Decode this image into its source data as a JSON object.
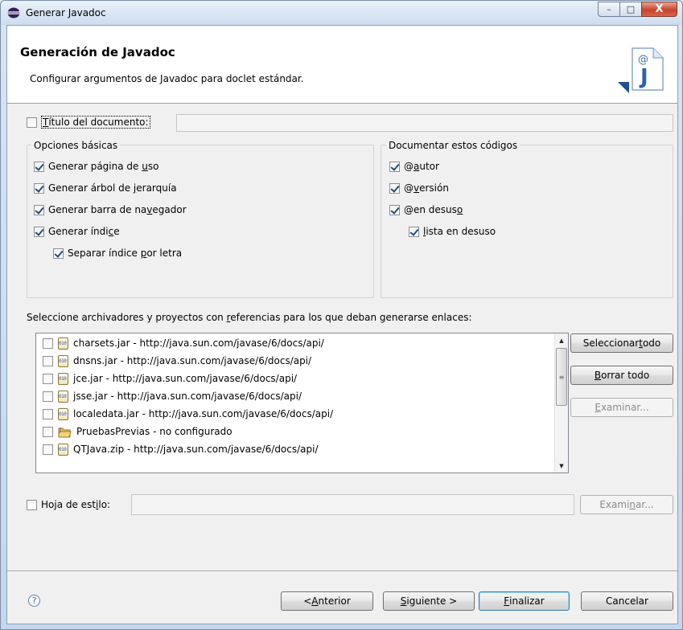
{
  "window": {
    "title": "Generar Javadoc",
    "controls": {
      "minimize": "–",
      "maximize": "□",
      "close": "X"
    }
  },
  "banner": {
    "heading": "Generación de Javadoc",
    "description": "Configurar argumentos de Javadoc para doclet estándar.",
    "icon": "javadoc-wizard-icon",
    "icon_letter": "J",
    "icon_at": "@"
  },
  "document_title": {
    "checked": false,
    "label_first": "T",
    "label_rest": "ítulo del documento:",
    "value": ""
  },
  "basic_options": {
    "legend": "Opciones básicas",
    "items": [
      {
        "pre": "Generar página de ",
        "u": "u",
        "post": "so",
        "checked": true
      },
      {
        "pre": "Generar árbol de ",
        "u": "j",
        "post": "erarquía",
        "checked": true
      },
      {
        "pre": "Generar barra de na",
        "u": "v",
        "post": "egador",
        "checked": true
      },
      {
        "pre": "Generar índi",
        "u": "c",
        "post": "e",
        "checked": true
      },
      {
        "pre": "Separar índice ",
        "u": "p",
        "post": "or letra",
        "checked": true
      }
    ]
  },
  "tags": {
    "legend": "Documentar estos códigos",
    "items": [
      {
        "pre": "@",
        "u": "a",
        "post": "utor",
        "checked": true
      },
      {
        "pre": "@",
        "u": "v",
        "post": "ersión",
        "checked": true
      },
      {
        "pre": "@en desus",
        "u": "o",
        "post": "",
        "checked": true
      },
      {
        "pre": "",
        "u": "l",
        "post": "ista en desuso",
        "checked": true
      }
    ]
  },
  "references": {
    "label_pre": "Seleccione archivadores y proyectos con ",
    "label_u": "r",
    "label_post": "eferencias para los que deban generarse enlaces:",
    "items": [
      {
        "text": "charsets.jar - http://java.sun.com/javase/6/docs/api/",
        "icon": "jar-icon",
        "checked": false
      },
      {
        "text": "dnsns.jar - http://java.sun.com/javase/6/docs/api/",
        "icon": "jar-icon",
        "checked": false
      },
      {
        "text": "jce.jar - http://java.sun.com/javase/6/docs/api/",
        "icon": "jar-icon",
        "checked": false
      },
      {
        "text": "jsse.jar - http://java.sun.com/javase/6/docs/api/",
        "icon": "jar-icon",
        "checked": false
      },
      {
        "text": "localedata.jar - http://java.sun.com/javase/6/docs/api/",
        "icon": "jar-icon",
        "checked": false
      },
      {
        "text": "PruebasPrevias - no configurado",
        "icon": "project-icon",
        "checked": false
      },
      {
        "text": "QTJava.zip - http://java.sun.com/javase/6/docs/api/",
        "icon": "jar-icon",
        "checked": false
      }
    ],
    "buttons": {
      "select_all_pre": "Seleccionar ",
      "select_all_u": "t",
      "select_all_post": "odo",
      "clear_all_pre": "",
      "clear_all_u": "B",
      "clear_all_post": "orrar todo",
      "browse_pre": "",
      "browse_u": "E",
      "browse_post": "xaminar..."
    }
  },
  "stylesheet": {
    "checked": false,
    "label_pre": "Hoja de est",
    "label_u": "i",
    "label_post": "lo:",
    "value": "",
    "browse_pre": "Exami",
    "browse_u": "n",
    "browse_post": "ar..."
  },
  "footer": {
    "help": "?",
    "back_pre": "< ",
    "back_u": "A",
    "back_post": "nterior",
    "next_pre": "",
    "next_u": "S",
    "next_post": "iguiente >",
    "finish_pre": "",
    "finish_u": "F",
    "finish_post": "inalizar",
    "cancel": "Cancelar"
  }
}
